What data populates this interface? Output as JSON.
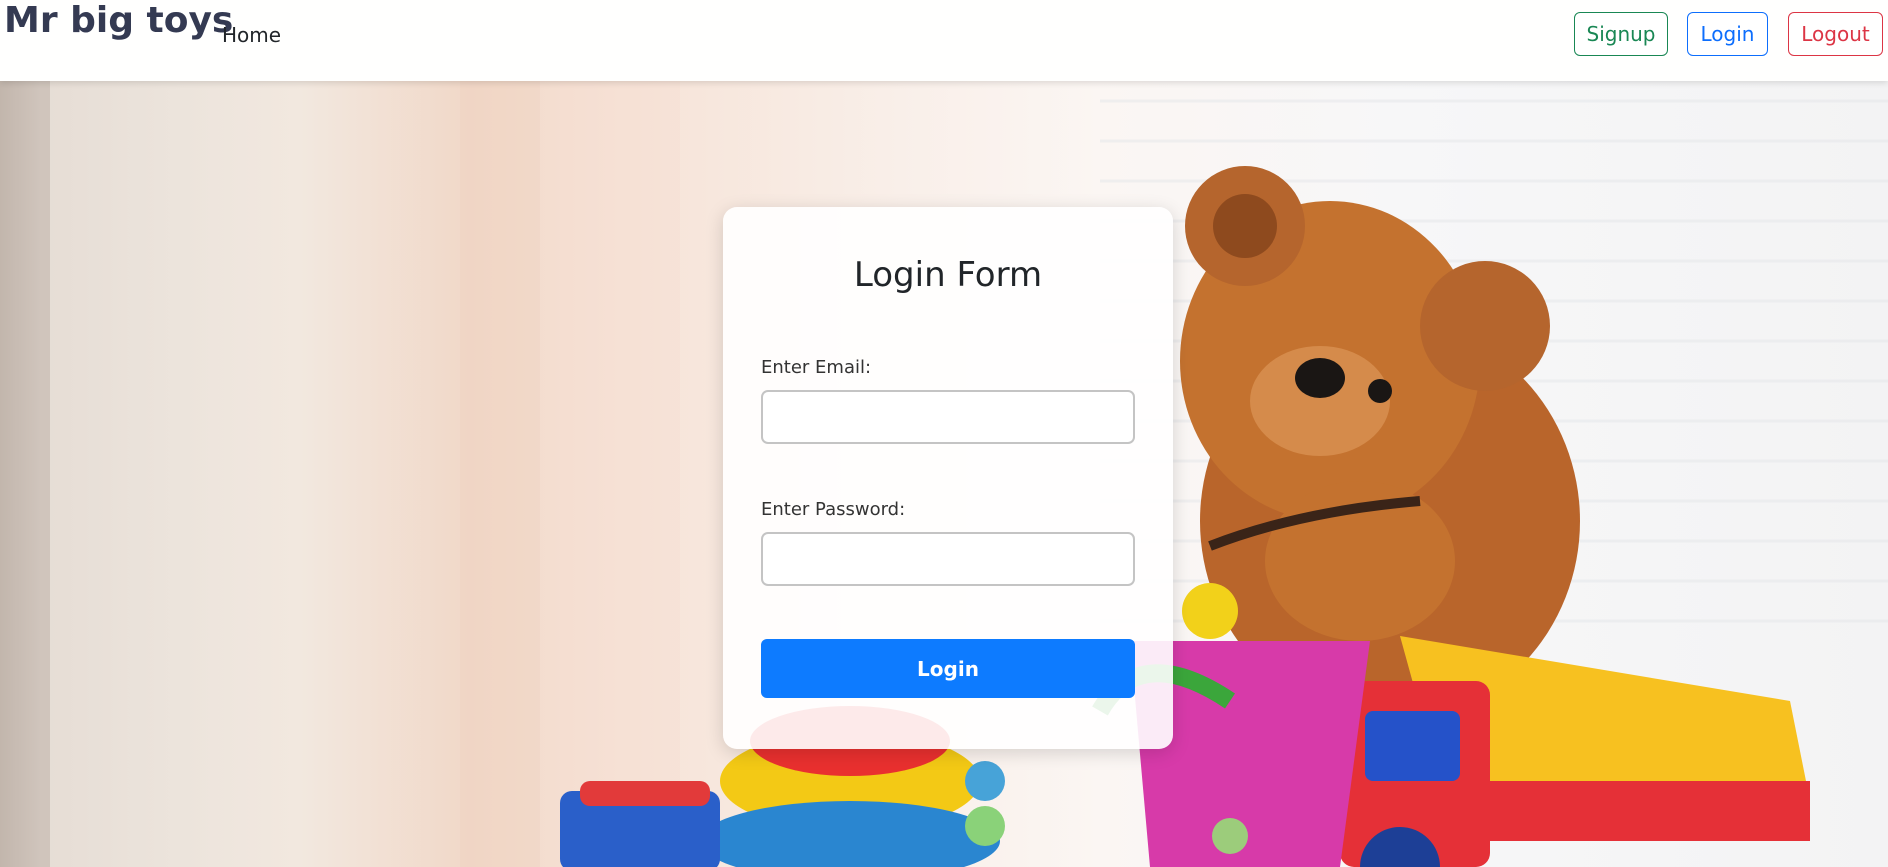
{
  "navbar": {
    "brand": "Mr big toys",
    "home_link": "Home",
    "signup_button": "Signup",
    "login_button": "Login",
    "logout_button": "Logout"
  },
  "login_form": {
    "title": "Login Form",
    "email_label": "Enter Email:",
    "email_value": "",
    "password_label": "Enter Password:",
    "password_value": "",
    "submit_label": "Login"
  },
  "colors": {
    "signup": "#198754",
    "login_outline": "#0d6efd",
    "logout": "#dc3545",
    "primary_button": "#0d7bff",
    "brand_text": "#343a52"
  }
}
